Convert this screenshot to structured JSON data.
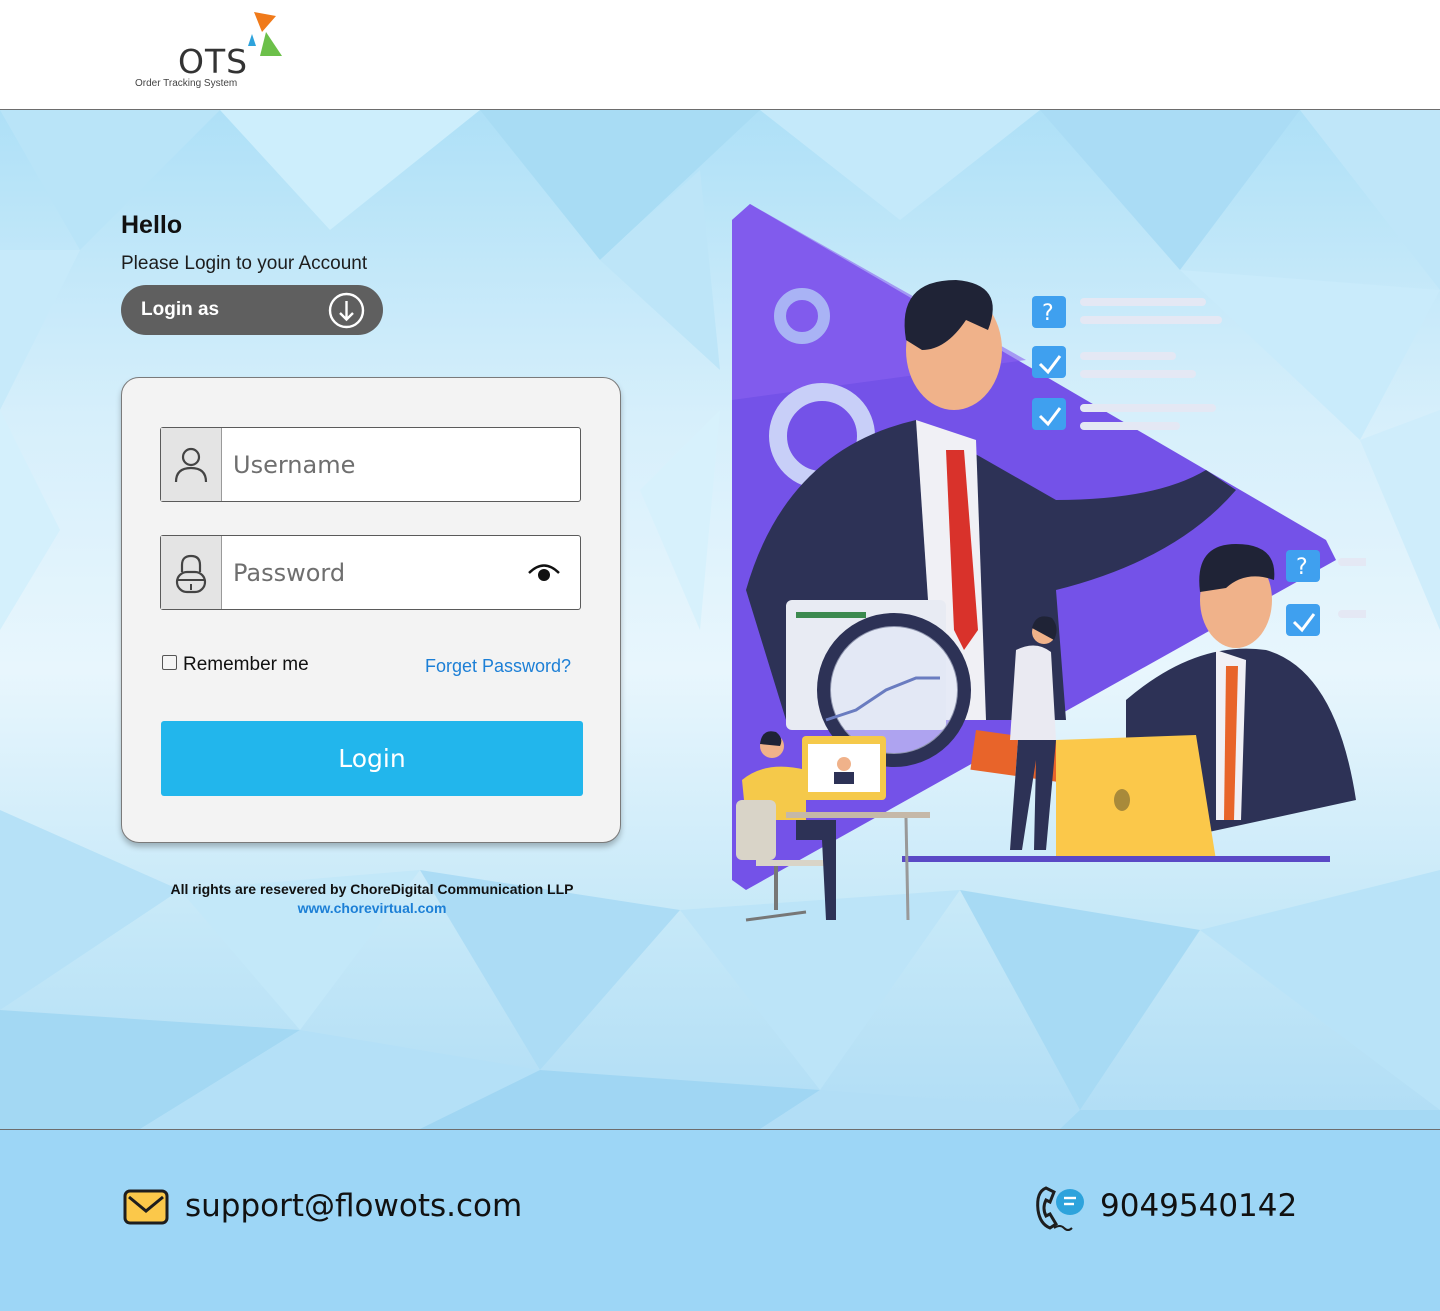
{
  "header": {
    "logo_text": "OTS",
    "logo_subtitle": "Order Tracking System"
  },
  "login": {
    "greeting": "Hello",
    "subtitle": "Please Login to your Account",
    "login_as_label": "Login as",
    "username_placeholder": "Username",
    "password_placeholder": "Password",
    "remember_label": "Remember me",
    "forgot_label": "Forget Password?",
    "submit_label": "Login"
  },
  "legal": {
    "rights": "All rights are resevered by ChoreDigital Communication LLP",
    "website": "www.chorevirtual.com"
  },
  "footer": {
    "email": "support@flowots.com",
    "phone": "9049540142"
  },
  "icons": {
    "login_as": "arrow-down-circle-icon",
    "username": "user-icon",
    "password": "lock-icon",
    "show_password": "eye-icon",
    "email": "mail-icon",
    "phone": "phone-chat-icon"
  },
  "colors": {
    "primary_button": "#22b6ec",
    "link": "#1c7fd6",
    "login_as_pill": "#5f5f5f",
    "footer_bg": "#9dd6f6",
    "logo_orange": "#f07a1a",
    "logo_blue": "#2ea3dc",
    "logo_green": "#6cc04a"
  }
}
